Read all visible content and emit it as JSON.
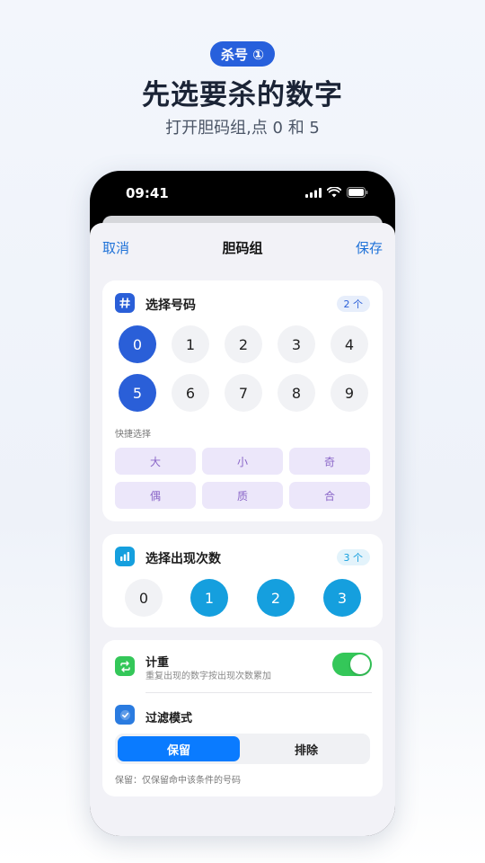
{
  "promo": {
    "badge": "杀号 ①",
    "headline": "先选要杀的数字",
    "subline": "打开胆码组,点 0 和 5"
  },
  "status_bar": {
    "time": "09:41"
  },
  "nav": {
    "cancel": "取消",
    "title": "胆码组",
    "save": "保存"
  },
  "numbers_card": {
    "icon": "hash-icon",
    "title": "选择号码",
    "count": "2 个",
    "digits": [
      {
        "label": "0",
        "selected": true
      },
      {
        "label": "1",
        "selected": false
      },
      {
        "label": "2",
        "selected": false
      },
      {
        "label": "3",
        "selected": false
      },
      {
        "label": "4",
        "selected": false
      },
      {
        "label": "5",
        "selected": true
      },
      {
        "label": "6",
        "selected": false
      },
      {
        "label": "7",
        "selected": false
      },
      {
        "label": "8",
        "selected": false
      },
      {
        "label": "9",
        "selected": false
      }
    ],
    "quick_label": "快捷选择",
    "quick_buttons": [
      "大",
      "小",
      "奇",
      "偶",
      "质",
      "合"
    ]
  },
  "occurrence_card": {
    "icon": "bar-chart-icon",
    "title": "选择出现次数",
    "count": "3 个",
    "options": [
      {
        "label": "0",
        "selected": false
      },
      {
        "label": "1",
        "selected": true
      },
      {
        "label": "2",
        "selected": true
      },
      {
        "label": "3",
        "selected": true
      }
    ]
  },
  "settings_card": {
    "weight": {
      "icon": "repeat-icon",
      "title": "计重",
      "subtitle": "重复出现的数字按出现次数累加",
      "enabled": true
    },
    "filter": {
      "icon": "checkmark-badge-icon",
      "title": "过滤模式",
      "options": [
        "保留",
        "排除"
      ],
      "selected": "保留",
      "hint": "保留：仅保留命中该条件的号码"
    }
  },
  "colors": {
    "accent_blue": "#2a5fd8",
    "occurrence_blue": "#159fde",
    "toggle_green": "#34c759",
    "segment_blue": "#0a7bff",
    "quick_purple": "#8a66c8"
  }
}
